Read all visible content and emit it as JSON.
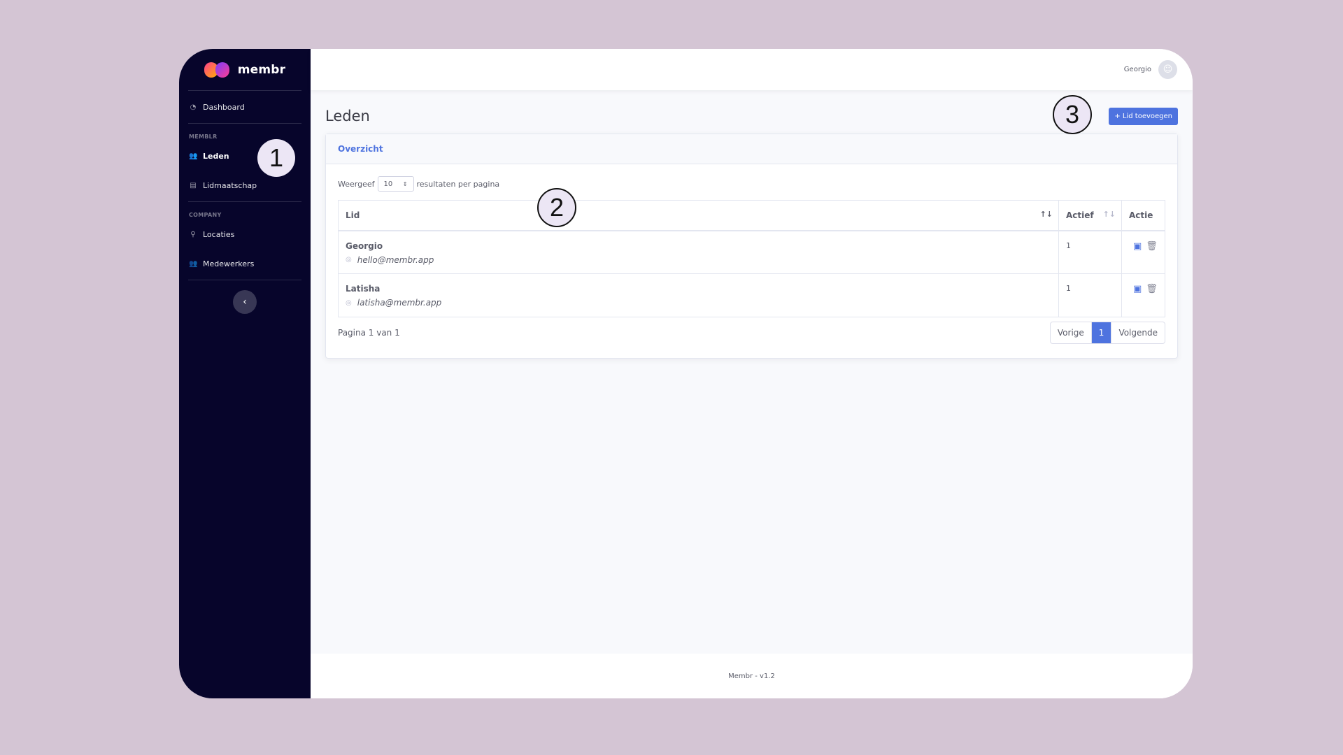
{
  "brand": {
    "name": "membr"
  },
  "sidebar": {
    "dashboard": "Dashboard",
    "section_membr": "MEMBLR",
    "leden": "Leden",
    "lidmaatschap": "Lidmaatschap",
    "section_company": "COMPANY",
    "locaties": "Locaties",
    "medewerkers": "Medewerkers",
    "collapse_symbol": "‹"
  },
  "topbar": {
    "user_name": "Georgio"
  },
  "page": {
    "title": "Leden",
    "add_button": "+ Lid toevoegen"
  },
  "card": {
    "header": "Overzicht",
    "length_prefix": "Weergeef",
    "length_value": "10",
    "length_suffix": "resultaten per pagina",
    "columns": {
      "member": "Lid",
      "active": "Actief",
      "action": "Actie"
    },
    "rows": [
      {
        "name": "Georgio",
        "email": "hello@membr.app",
        "active": "1"
      },
      {
        "name": "Latisha",
        "email": "latisha@membr.app",
        "active": "1"
      }
    ],
    "page_info": "Pagina 1 van 1",
    "pagination": {
      "prev": "Vorige",
      "current": "1",
      "next": "Volgende"
    }
  },
  "footer": {
    "text": "Membr - v1.2"
  },
  "callouts": {
    "one": "1",
    "two": "2",
    "three": "3"
  },
  "colors": {
    "sidebar": "#07052b",
    "accent": "#4e73df",
    "background": "#d4c5d4"
  },
  "icons": [
    "dashboard-icon",
    "users-icon",
    "id-card-icon",
    "map-pin-icon",
    "team-icon",
    "user-avatar-icon",
    "sort-icon",
    "at-icon",
    "edit-icon",
    "trash-icon"
  ]
}
